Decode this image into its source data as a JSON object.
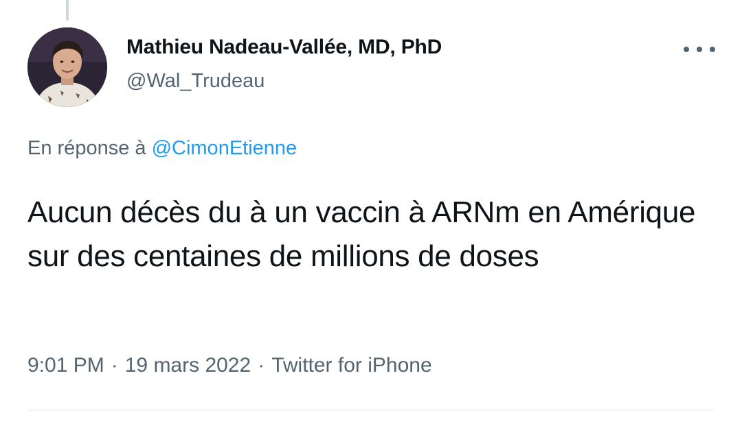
{
  "tweet": {
    "author": {
      "display_name": "Mathieu Nadeau-Vallée, MD, PhD",
      "handle": "@Wal_Trudeau",
      "avatar_icon": "user-avatar"
    },
    "more_icon": "more-horizontal-icon",
    "reply_context": {
      "prefix": "En réponse à",
      "mention": "@CimonEtienne"
    },
    "text": "Aucun décès du à un vaccin à ARNm en Amérique sur des centaines de millions de doses",
    "meta": {
      "time": "9:01 PM",
      "date": "19 mars 2022",
      "source": "Twitter for iPhone",
      "separator": "·"
    }
  },
  "colors": {
    "text": "#0f1419",
    "secondary": "#536471",
    "link": "#1d9bf0",
    "thread_line": "#cfd9de"
  }
}
